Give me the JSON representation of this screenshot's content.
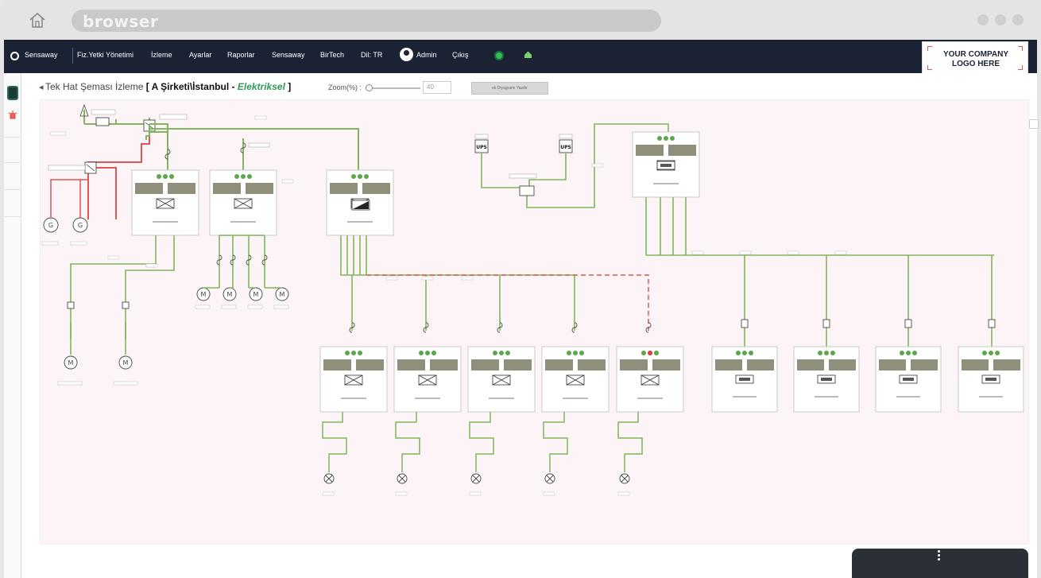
{
  "browser": {
    "title": "browser",
    "home_icon": "home-icon",
    "window_controls": [
      "dot",
      "dot",
      "dot"
    ]
  },
  "nav": {
    "brand": "Sensaway",
    "items": [
      "Fiz.Yetki Yönetimi",
      "İzleme",
      "Ayarlar",
      "Raporlar",
      "Sensaway",
      "BirTech",
      "Dil: TR"
    ],
    "user": "Admin",
    "logout": "Çıkış",
    "status_color": "#2fbf5b"
  },
  "logo": {
    "line1": "YOUR COMPANY",
    "line2": "LOGO HERE"
  },
  "page": {
    "back_arrow": "◂",
    "title_prefix": "Tek Hat Şeması İzleme",
    "title_open": "[ A Şirketi\\İstanbul -",
    "title_emph": "Elektriksel",
    "title_close": "]",
    "zoom_label": "Zoom(%) :",
    "zoom_value": "40",
    "diagram_button": "ek Diyagramı Yazdır"
  },
  "diagram": {
    "ups_label": "UPS",
    "motor_symbol": "M",
    "generator_symbol": "G",
    "energized_color": "#7fb75a",
    "fault_color": "#e05555",
    "panel_color": "#8f8f7c",
    "status_ok_color": "#5aa84a",
    "status_alarm_color": "#e04040"
  }
}
